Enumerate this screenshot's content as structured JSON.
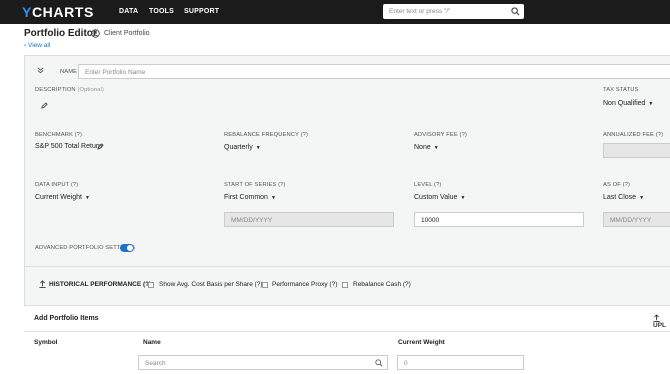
{
  "brand": {
    "prefix": "Y",
    "rest": "CHARTS"
  },
  "nav": {
    "data": "DATA",
    "tools": "TOOLS",
    "support": "SUPPORT"
  },
  "search": {
    "placeholder": "Enter text or press \"/\""
  },
  "header": {
    "title": "Portfolio Editor",
    "client_portfolio": "Client Portfolio",
    "view_all": "View all"
  },
  "form": {
    "name_label": "NAME",
    "name_placeholder": "Enter Portfolio Name",
    "description_label": "DESCRIPTION",
    "optional": "(Optional)",
    "tax_status_label": "TAX STATUS",
    "tax_status_value": "Non Qualified",
    "benchmark_label": "BENCHMARK (?)",
    "benchmark_value": "S&P 500 Total Return",
    "rebalance_label": "REBALANCE FREQUENCY (?)",
    "rebalance_value": "Quarterly",
    "advisory_fee_label": "ADVISORY FEE (?)",
    "advisory_fee_value": "None",
    "annualized_fee_label": "ANNUALIZED FEE (?)",
    "data_input_label": "DATA INPUT (?)",
    "data_input_value": "Current Weight",
    "start_series_label": "START OF SERIES (?)",
    "start_series_value": "First Common",
    "start_date_placeholder": "MM/DD/YYYY",
    "level_label": "LEVEL (?)",
    "level_value": "Custom Value",
    "level_input": "10000",
    "as_of_label": "AS OF (?)",
    "as_of_value": "Last Close",
    "as_of_date_placeholder": "MM/DD/YYYY",
    "advanced_label": "ADVANCED PORTFOLIO SETTINGS",
    "advanced_on": true,
    "historical_performance": "HISTORICAL PERFORMANCE (?)",
    "show_avg_cost": "Show Avg. Cost Basis per Share (?)",
    "performance_proxy": "Performance Proxy (?)",
    "rebalance_cash": "Rebalance Cash (?)"
  },
  "items": {
    "title": "Add Portfolio Items",
    "upload": "UPL",
    "col_symbol": "Symbol",
    "col_name": "Name",
    "col_weight": "Current Weight",
    "search_placeholder": "Search",
    "weight_input": "0"
  },
  "colors": {
    "accent": "#1a73c8",
    "topbar": "#1b1b1b",
    "panel": "#f4f5f5"
  }
}
